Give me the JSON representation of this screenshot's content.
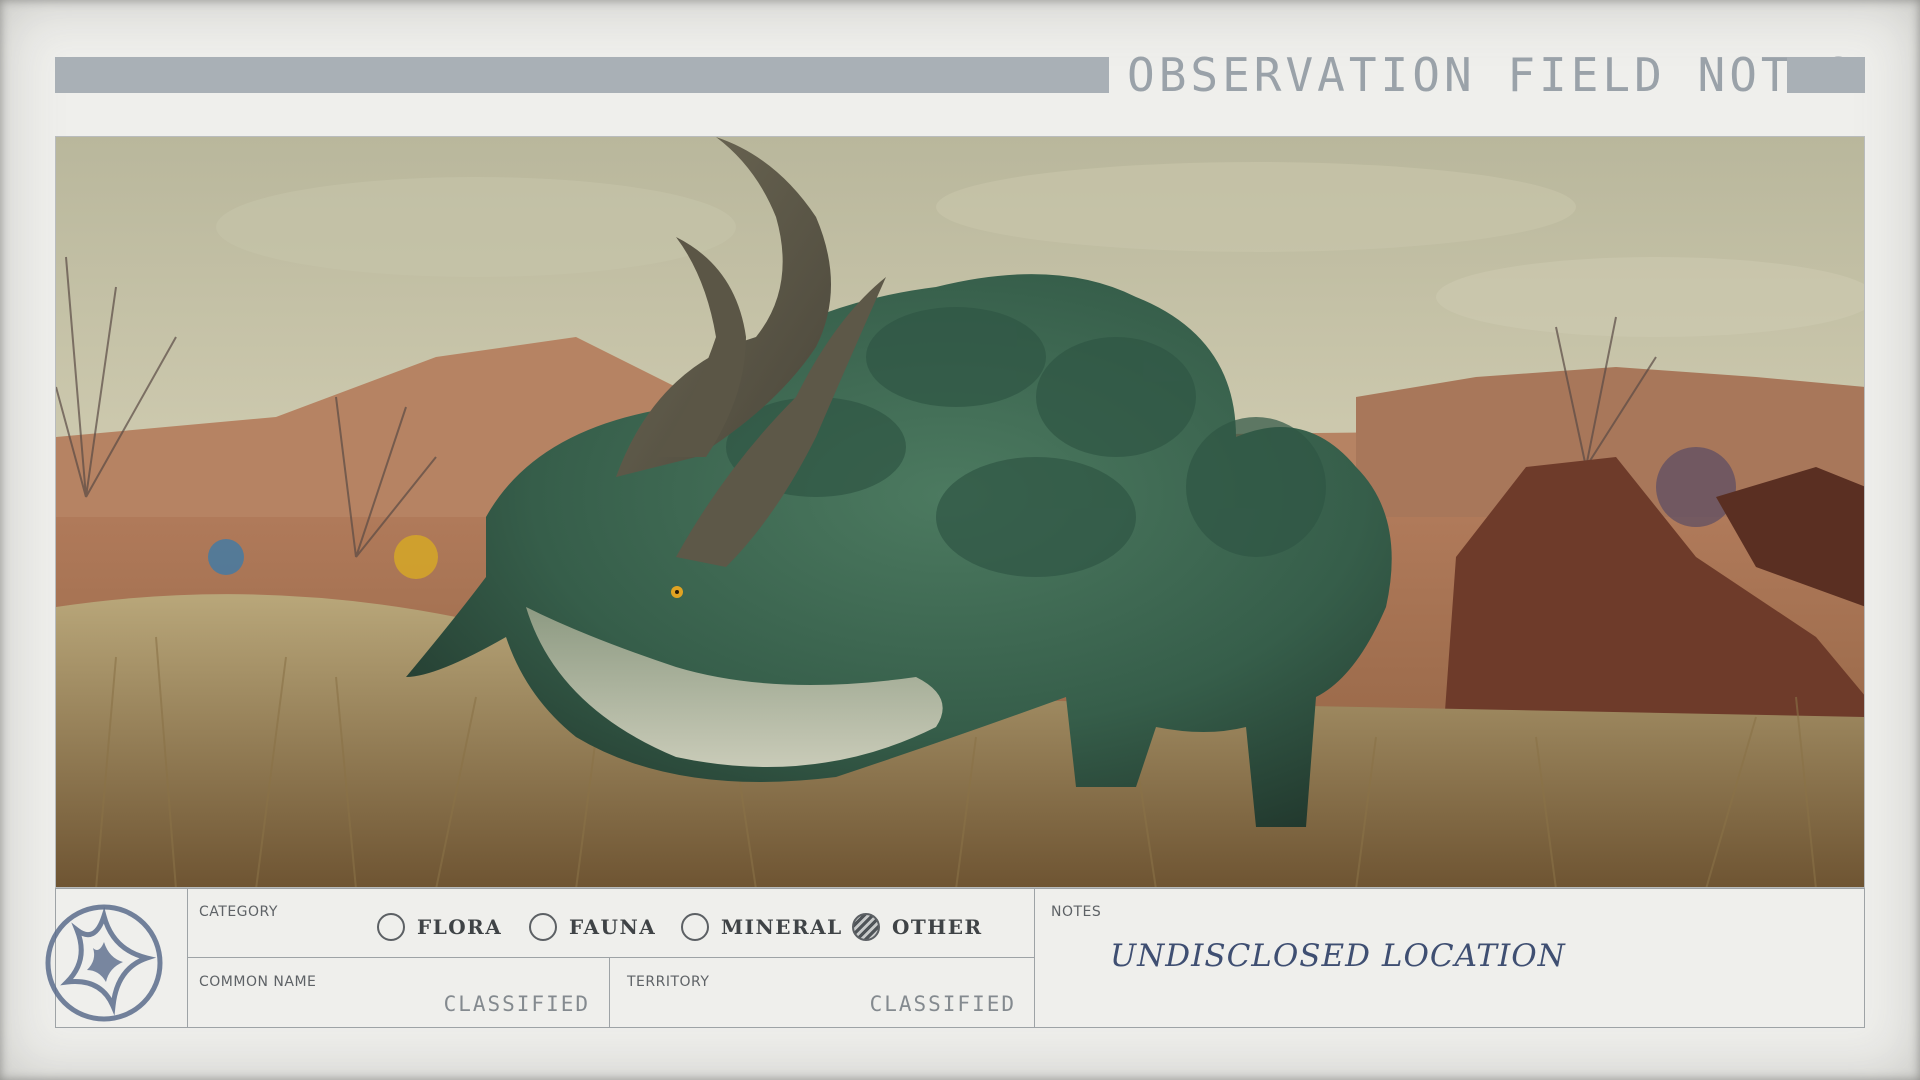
{
  "header": {
    "title": "OBSERVATION FIELD NOTES"
  },
  "photo": {
    "subject_icon": "horned-creature-photo"
  },
  "category": {
    "label": "CATEGORY",
    "options": [
      {
        "label": "FLORA",
        "selected": false
      },
      {
        "label": "FAUNA",
        "selected": false
      },
      {
        "label": "MINERAL",
        "selected": false
      },
      {
        "label": "OTHER",
        "selected": true
      }
    ]
  },
  "common_name": {
    "label": "COMMON NAME",
    "value": "CLASSIFIED"
  },
  "territory": {
    "label": "TERRITORY",
    "value": "CLASSIFIED"
  },
  "notes": {
    "label": "NOTES",
    "text": "UNDISCLOSED LOCATION"
  },
  "logo": {
    "icon": "star-emblem-icon"
  },
  "colors": {
    "paper": "#efefec",
    "header_bar": "#a9b0b6",
    "ink_blue": "#3f4f72",
    "stamp_blue": "#5a6c8c"
  }
}
